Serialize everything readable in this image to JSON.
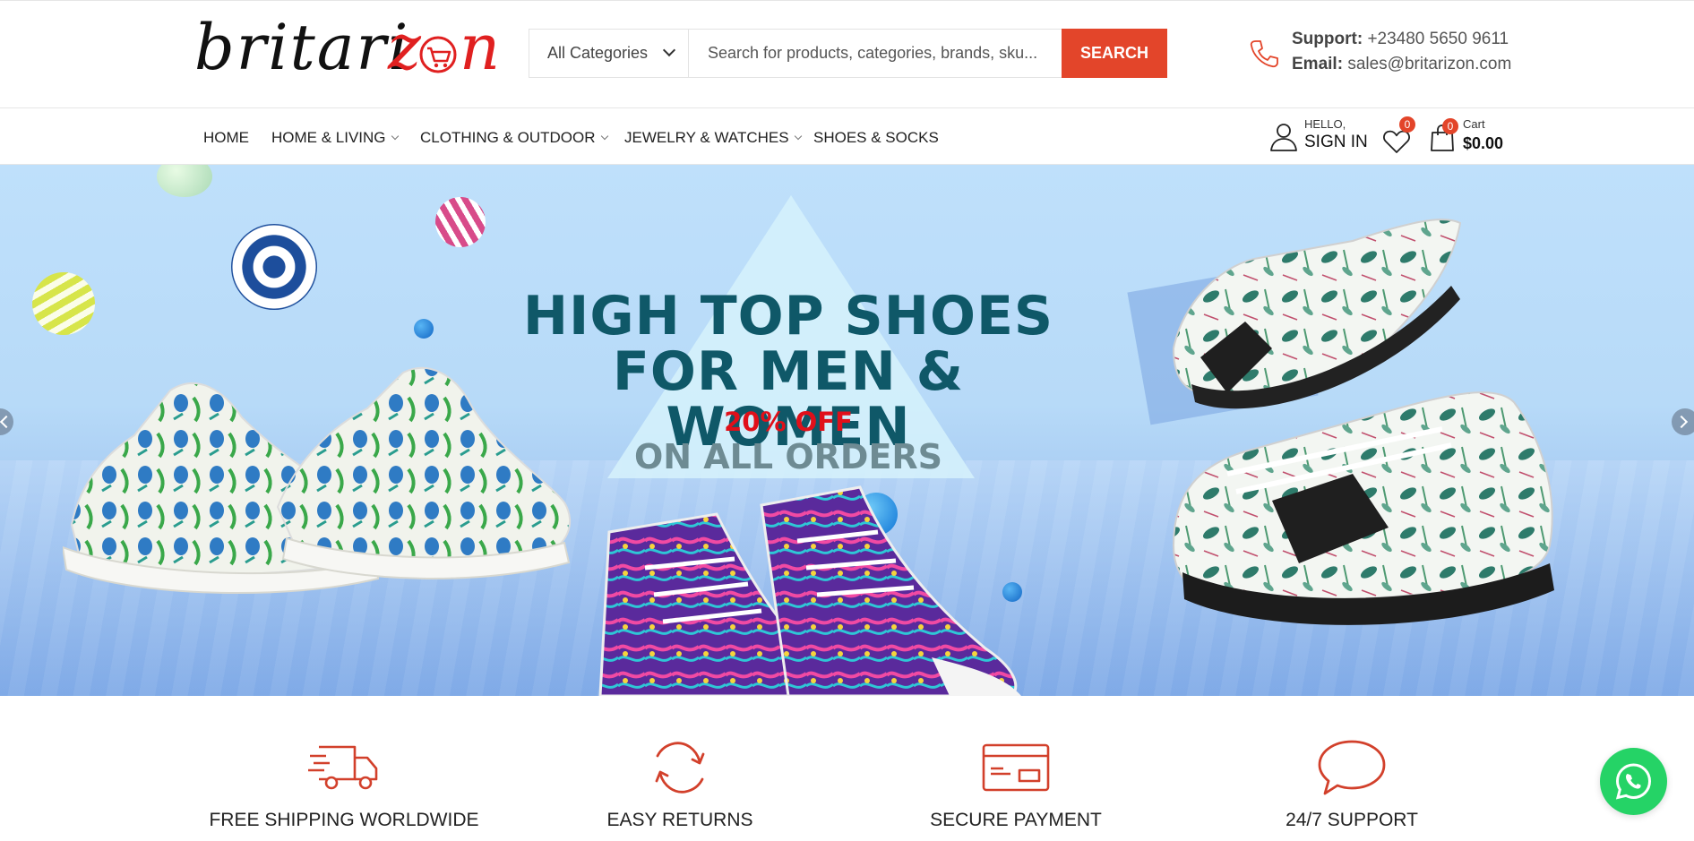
{
  "brand": {
    "name": "britarizon"
  },
  "search": {
    "category_selected": "All Categories",
    "placeholder": "Search for products, categories, brands, sku...",
    "button_label": "SEARCH"
  },
  "support": {
    "phone_label": "Support:",
    "phone_value": "+23480 5650 9611",
    "email_label": "Email:",
    "email_value": "sales@britarizon.com"
  },
  "nav": {
    "items": [
      {
        "label": "HOME",
        "dropdown": false
      },
      {
        "label": "HOME & LIVING",
        "dropdown": true
      },
      {
        "label": "CLOTHING & OUTDOOR",
        "dropdown": true
      },
      {
        "label": "JEWELRY & WATCHES",
        "dropdown": true
      },
      {
        "label": "SHOES & SOCKS",
        "dropdown": false
      }
    ]
  },
  "account": {
    "greeting": "HELLO,",
    "signin_label": "SIGN IN"
  },
  "wishlist": {
    "count": "0"
  },
  "cart": {
    "label": "Cart",
    "count": "0",
    "total": "$0.00"
  },
  "hero": {
    "title_line1": "HIGH TOP SHOES",
    "title_line2": "FOR MEN & WOMEN",
    "discount": "20% OFF",
    "subtitle": "ON ALL ORDERS"
  },
  "features": [
    {
      "label": "FREE SHIPPING WORLDWIDE",
      "icon": "truck-icon"
    },
    {
      "label": "EASY RETURNS",
      "icon": "refresh-icon"
    },
    {
      "label": "SECURE PAYMENT",
      "icon": "credit-card-icon"
    },
    {
      "label": "24/7 SUPPORT",
      "icon": "chat-bubble-icon"
    }
  ],
  "colors": {
    "accent": "#e3452a",
    "hero_title": "#0f5868",
    "hero_discount": "#e0101a",
    "whatsapp": "#25d366"
  }
}
